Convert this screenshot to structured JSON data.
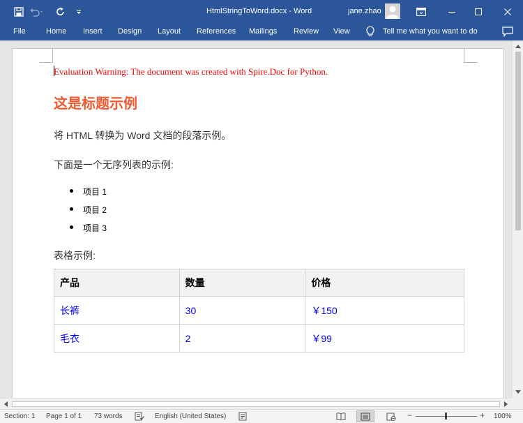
{
  "window": {
    "title": "HtmlStringToWord.docx  -  Word",
    "user": "jane.zhao",
    "colors": {
      "titlebar": "#2b579a",
      "heading": "#f15a30",
      "warning": "#ff0000",
      "link_text": "#0000ff"
    }
  },
  "quick_access": {
    "icons": [
      "save-icon",
      "undo-icon",
      "redo-icon",
      "customize-icon"
    ]
  },
  "window_controls": {
    "icons": [
      "ribbon-display-options-icon",
      "minimize-icon",
      "maximize-icon",
      "close-icon"
    ]
  },
  "ribbon": {
    "tabs": [
      "File",
      "Home",
      "Insert",
      "Design",
      "Layout",
      "References",
      "Mailings",
      "Review",
      "View"
    ],
    "tell_me": "Tell me what you want to do"
  },
  "document": {
    "warning": "Evaluation Warning: The document was created with Spire.Doc for Python.",
    "heading": "这是标题示例",
    "paragraph1": "将 HTML 转换为 Word 文档的段落示例。",
    "paragraph2": "下面是一个无序列表的示例:",
    "list": [
      "项目 1",
      "项目 2",
      "项目 3"
    ],
    "table_caption": "表格示例:",
    "table": {
      "headers": [
        "产品",
        "数量",
        "价格"
      ],
      "rows": [
        [
          "长裤",
          "30",
          "￥150"
        ],
        [
          "毛衣",
          "2",
          "￥99"
        ]
      ]
    }
  },
  "status": {
    "section": "Section: 1",
    "page": "Page 1 of 1",
    "words": "73 words",
    "language": "English (United States)",
    "zoom": "100%",
    "zoom_minus": "−",
    "zoom_plus": "+"
  }
}
